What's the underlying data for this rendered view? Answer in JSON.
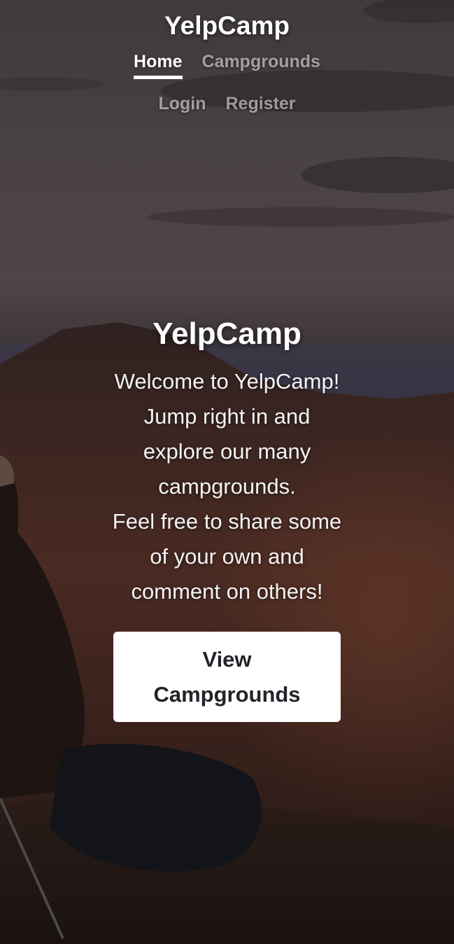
{
  "nav": {
    "brand": "YelpCamp",
    "links": [
      {
        "label": "Home",
        "active": true
      },
      {
        "label": "Campgrounds",
        "active": false
      },
      {
        "label": "Login",
        "active": false
      },
      {
        "label": "Register",
        "active": false
      }
    ]
  },
  "hero": {
    "title": "YelpCamp",
    "paragraphs": [
      "Welcome to YelpCamp!",
      "Jump right in and explore our many campgrounds.",
      "Feel free to share some of your own and comment on others!"
    ],
    "button_label": "View Campgrounds"
  }
}
